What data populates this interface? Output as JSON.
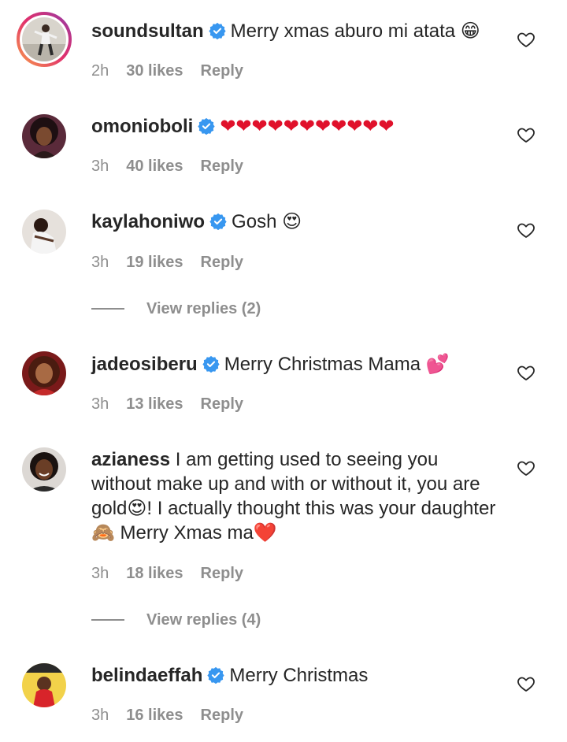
{
  "comments": [
    {
      "username": "soundsultan",
      "text": "Merry xmas aburo mi atata 😁",
      "time": "2h",
      "likes": "30 likes",
      "reply": "Reply",
      "verified": true,
      "story_ring": true
    },
    {
      "username": "omonioboli",
      "text": "❤❤❤❤❤❤❤❤❤❤❤",
      "time": "3h",
      "likes": "40 likes",
      "reply": "Reply",
      "verified": true
    },
    {
      "username": "kaylahoniwo",
      "text": "Gosh 😍",
      "time": "3h",
      "likes": "19 likes",
      "reply": "Reply",
      "verified": true,
      "view_replies": "View replies (2)"
    },
    {
      "username": "jadeosiberu",
      "text": "Merry Christmas Mama 💕",
      "time": "3h",
      "likes": "13 likes",
      "reply": "Reply",
      "verified": true
    },
    {
      "username": "azianess",
      "text": "I am getting used to seeing you without make up and with or without it, you are gold😍! I actually thought this was your daughter🙈 Merry Xmas ma❤️",
      "time": "3h",
      "likes": "18 likes",
      "reply": "Reply",
      "verified": false,
      "view_replies": "View replies (4)"
    },
    {
      "username": "belindaeffah",
      "text": "Merry Christmas",
      "time": "3h",
      "likes": "16 likes",
      "reply": "Reply",
      "verified": true
    }
  ],
  "colors": {
    "text": "#262626",
    "muted": "#8e8e8e",
    "verified_blue": "#3897f0",
    "heart_red": "#e0112b"
  },
  "icons": {
    "verified": "verified-badge-icon",
    "like": "heart-outline-icon"
  }
}
